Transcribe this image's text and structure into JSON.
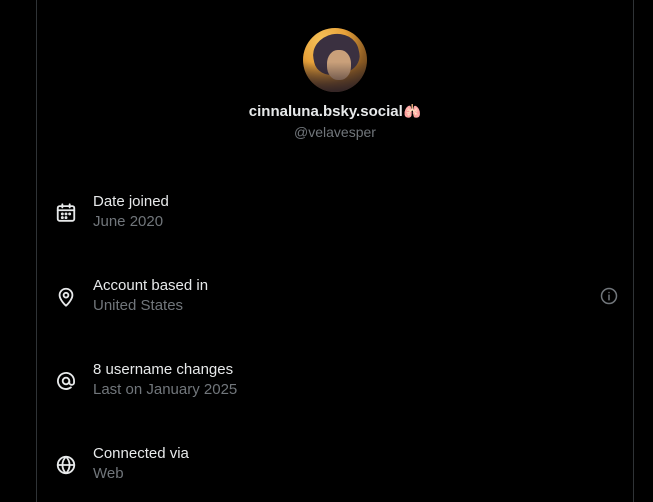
{
  "profile": {
    "display_name": "cinnaluna.bsky.social",
    "display_name_emoji": "🫁",
    "handle": "@velavesper"
  },
  "rows": [
    {
      "icon": "calendar-icon",
      "title": "Date joined",
      "subtitle": "June 2020"
    },
    {
      "icon": "location-pin-icon",
      "title": "Account based in",
      "subtitle": "United States"
    },
    {
      "icon": "at-sign-icon",
      "title": "8 username changes",
      "subtitle": "Last on January 2025"
    },
    {
      "icon": "globe-icon",
      "title": "Connected via",
      "subtitle": "Web"
    }
  ],
  "colors": {
    "background": "#000000",
    "primary_text": "#e7e9ea",
    "secondary_text": "#71767b",
    "border": "#2f3336"
  }
}
